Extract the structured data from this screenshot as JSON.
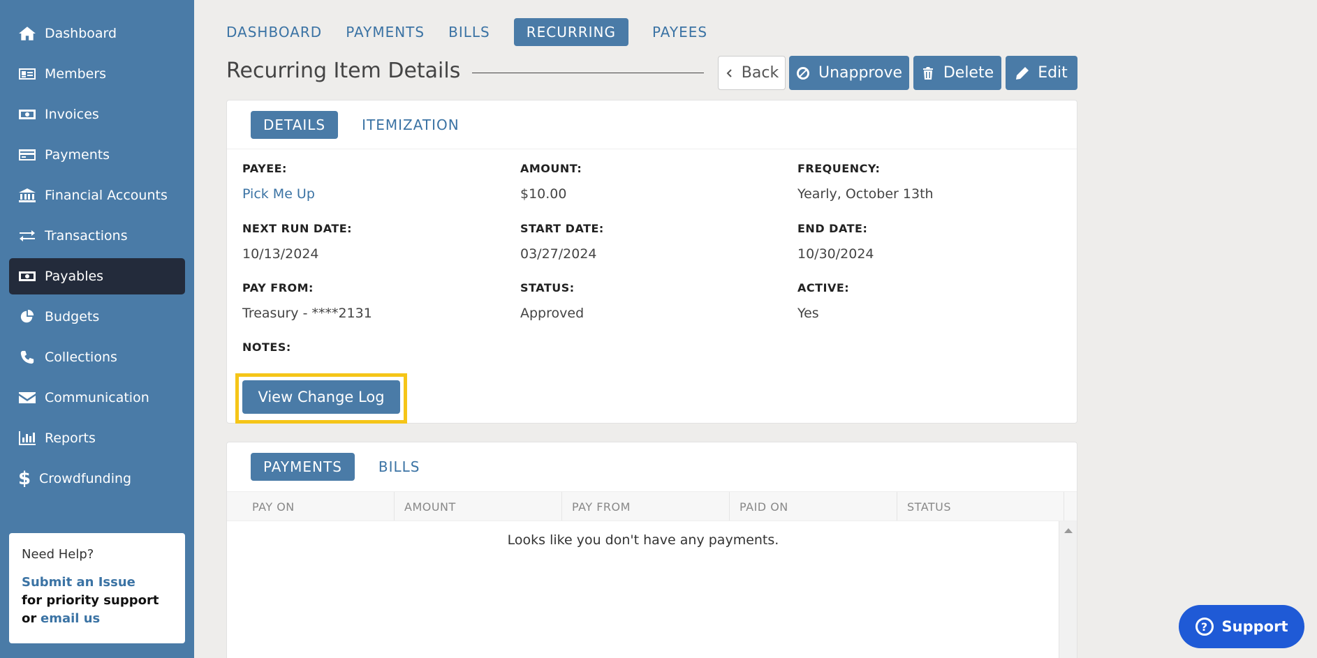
{
  "sidebar": {
    "items": [
      {
        "label": "Dashboard",
        "icon": "home-icon"
      },
      {
        "label": "Members",
        "icon": "id-card-icon"
      },
      {
        "label": "Invoices",
        "icon": "money-bill-icon"
      },
      {
        "label": "Payments",
        "icon": "credit-card-icon"
      },
      {
        "label": "Financial Accounts",
        "icon": "bank-icon"
      },
      {
        "label": "Transactions",
        "icon": "exchange-icon"
      },
      {
        "label": "Payables",
        "icon": "money-bill-icon"
      },
      {
        "label": "Budgets",
        "icon": "pie-chart-icon"
      },
      {
        "label": "Collections",
        "icon": "phone-icon"
      },
      {
        "label": "Communication",
        "icon": "envelope-icon"
      },
      {
        "label": "Reports",
        "icon": "bar-chart-icon"
      },
      {
        "label": "Crowdfunding",
        "icon": "dollar-icon"
      }
    ],
    "active_item": "Payables",
    "help": {
      "heading": "Need Help?",
      "submit_link": "Submit an Issue",
      "priority_text": "for priority support",
      "or_text": "or",
      "email_link": "email us"
    }
  },
  "top_tabs": {
    "items": [
      "DASHBOARD",
      "PAYMENTS",
      "BILLS",
      "RECURRING",
      "PAYEES"
    ],
    "active": "RECURRING"
  },
  "header": {
    "title": "Recurring Item Details",
    "back_label": "Back",
    "unapprove_label": "Unapprove",
    "delete_label": "Delete",
    "edit_label": "Edit"
  },
  "details": {
    "tabs": [
      "DETAILS",
      "ITEMIZATION"
    ],
    "active_tab": "DETAILS",
    "fields": {
      "payee": {
        "label": "PAYEE:",
        "value": "Pick Me Up"
      },
      "amount": {
        "label": "AMOUNT:",
        "value": "$10.00"
      },
      "frequency": {
        "label": "FREQUENCY:",
        "value": "Yearly, October 13th"
      },
      "next_run_date": {
        "label": "NEXT RUN DATE:",
        "value": "10/13/2024"
      },
      "start_date": {
        "label": "START DATE:",
        "value": "03/27/2024"
      },
      "end_date": {
        "label": "END DATE:",
        "value": "10/30/2024"
      },
      "pay_from": {
        "label": "PAY FROM:",
        "value": "Treasury - ****2131"
      },
      "status": {
        "label": "STATUS:",
        "value": "Approved"
      },
      "active": {
        "label": "ACTIVE:",
        "value": "Yes"
      },
      "notes": {
        "label": "NOTES:",
        "value": ""
      }
    },
    "change_log_label": "View Change Log"
  },
  "payments": {
    "tabs": [
      "PAYMENTS",
      "BILLS"
    ],
    "active_tab": "PAYMENTS",
    "columns": [
      "PAY ON",
      "AMOUNT",
      "PAY FROM",
      "PAID ON",
      "STATUS"
    ],
    "empty_message": "Looks like you don't have any payments."
  },
  "support": {
    "label": "Support"
  },
  "colors": {
    "sidebar": "#4a7ba7",
    "active_nav": "#232b3b",
    "accent": "#4a7ba7",
    "highlight": "#f5c518",
    "support": "#1f5ad6"
  }
}
